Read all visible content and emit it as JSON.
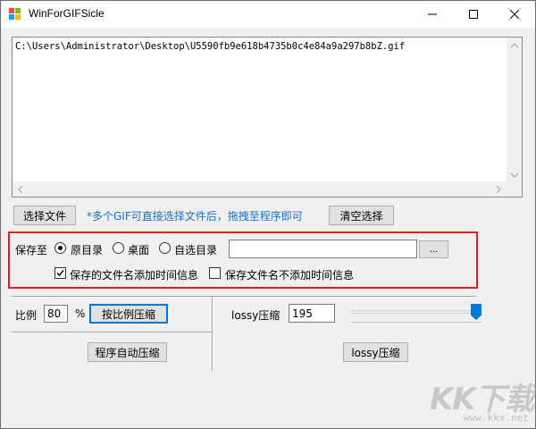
{
  "window": {
    "title": "WinForGIFSicle",
    "controls": {
      "minimize_icon": "minimize-icon",
      "maximize_icon": "maximize-icon",
      "close_icon": "close-icon"
    }
  },
  "file_list": {
    "items": [
      "C:\\Users\\Administrator\\Desktop\\U5590fb9e618b4735b0c4e84a9a297b8bZ.gif"
    ]
  },
  "file_actions": {
    "select_file_label": "选择文件",
    "hint": "*多个GIF可直接选择文件后，拖拽至程序即可",
    "clear_selection_label": "清空选择"
  },
  "save_options": {
    "save_to_label": "保存至",
    "radios": [
      {
        "label": "原目录",
        "selected": true
      },
      {
        "label": "桌面",
        "selected": false
      },
      {
        "label": "自选目录",
        "selected": false
      }
    ],
    "custom_dir_value": "",
    "browse_label": "...",
    "checkboxes": [
      {
        "label": "保存的文件名添加时间信息",
        "checked": true
      },
      {
        "label": "保存文件名不添加时间信息",
        "checked": false
      }
    ],
    "highlight_color": "#e01b24"
  },
  "ratio_compress": {
    "ratio_label": "比例",
    "ratio_value": "80",
    "percent_label": "%",
    "compress_button_label": "按比例压缩",
    "auto_compress_label": "程序自动压缩"
  },
  "lossy_compress": {
    "label": "lossy压缩",
    "value": "195",
    "slider_level": 1.0,
    "button_label": "lossy压缩",
    "accent_color": "#0078d7"
  },
  "watermark": {
    "text": "KK下载",
    "url": "www.kkx.net"
  }
}
